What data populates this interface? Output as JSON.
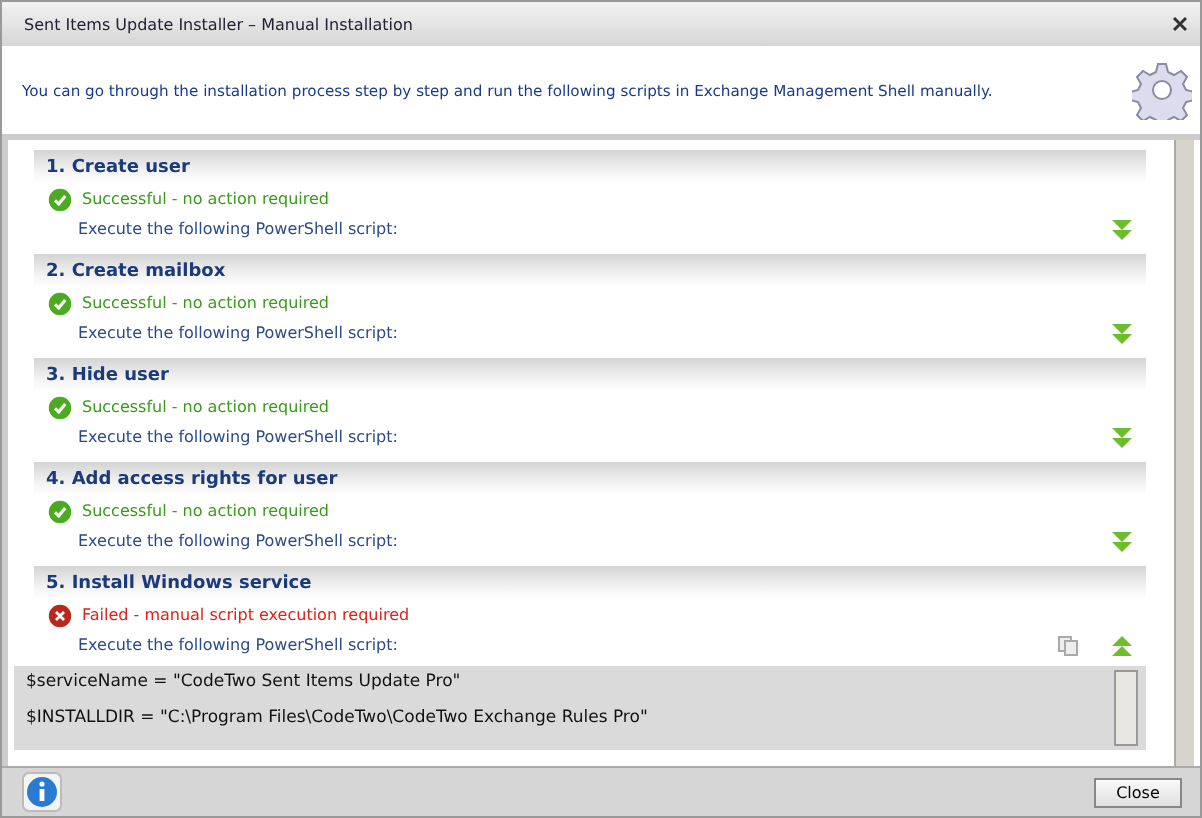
{
  "window": {
    "title": "Sent Items Update Installer – Manual Installation"
  },
  "intro": "You can go through the installation process step by step and run the following scripts in Exchange Management Shell manually.",
  "steps": [
    {
      "title": "1. Create user",
      "kind": "success",
      "status_text": "Successful - no action required",
      "execute_text": "Execute the following PowerShell script:",
      "expanded": false
    },
    {
      "title": "2. Create mailbox",
      "kind": "success",
      "status_text": "Successful - no action required",
      "execute_text": "Execute the following PowerShell script:",
      "expanded": false
    },
    {
      "title": "3. Hide user",
      "kind": "success",
      "status_text": "Successful - no action required",
      "execute_text": "Execute the following PowerShell script:",
      "expanded": false
    },
    {
      "title": "4. Add access rights for user",
      "kind": "success",
      "status_text": "Successful - no action required",
      "execute_text": "Execute the following PowerShell script:",
      "expanded": false
    },
    {
      "title": "5. Install Windows service",
      "kind": "failed",
      "status_text": "Failed - manual script execution required",
      "execute_text": "Execute the following PowerShell script:",
      "expanded": true,
      "script": [
        "$serviceName = \"CodeTwo Sent Items Update Pro\"",
        "$INSTALLDIR = \"C:\\Program Files\\CodeTwo\\CodeTwo Exchange Rules Pro\""
      ]
    }
  ],
  "buttons": {
    "close": "Close"
  }
}
